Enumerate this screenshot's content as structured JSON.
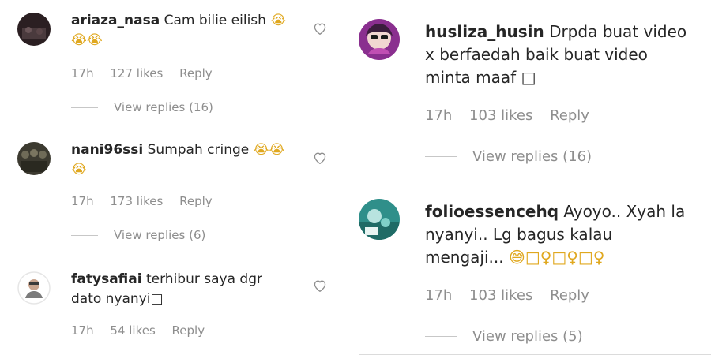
{
  "left_comments": [
    {
      "username": "ariaza_nasa",
      "text": "Cam bilie eilish",
      "emoji": "😭😭😭",
      "time": "17h",
      "likes": "127 likes",
      "reply": "Reply",
      "view_replies": "View replies (16)"
    },
    {
      "username": "nani96ssi",
      "text": "Sumpah cringe",
      "emoji": "😭😭😭",
      "time": "17h",
      "likes": "173 likes",
      "reply": "Reply",
      "view_replies": "View replies (6)"
    },
    {
      "username": "fatysafiai",
      "text": "terhibur saya dgr dato nyanyi□",
      "time": "17h",
      "likes": "54 likes",
      "reply": "Reply"
    }
  ],
  "right_comments": [
    {
      "username": "husliza_husin",
      "text": "Drpda buat video x berfaedah baik buat video minta maaf □",
      "time": "17h",
      "likes": "103 likes",
      "reply": "Reply",
      "view_replies": "View replies (16)"
    },
    {
      "username": "folioessencehq",
      "text": "Ayoyo.. Xyah la nyanyi.. Lg bagus kalau mengaji...",
      "emoji": "😅□♀□♀□♀",
      "time": "17h",
      "likes": "103 likes",
      "reply": "Reply",
      "view_replies": "View replies (5)"
    }
  ],
  "icons": {
    "heart": "heart-icon"
  },
  "colors": {
    "text": "#262626",
    "meta": "#8e8e8e",
    "divider": "#dbdbdb"
  }
}
